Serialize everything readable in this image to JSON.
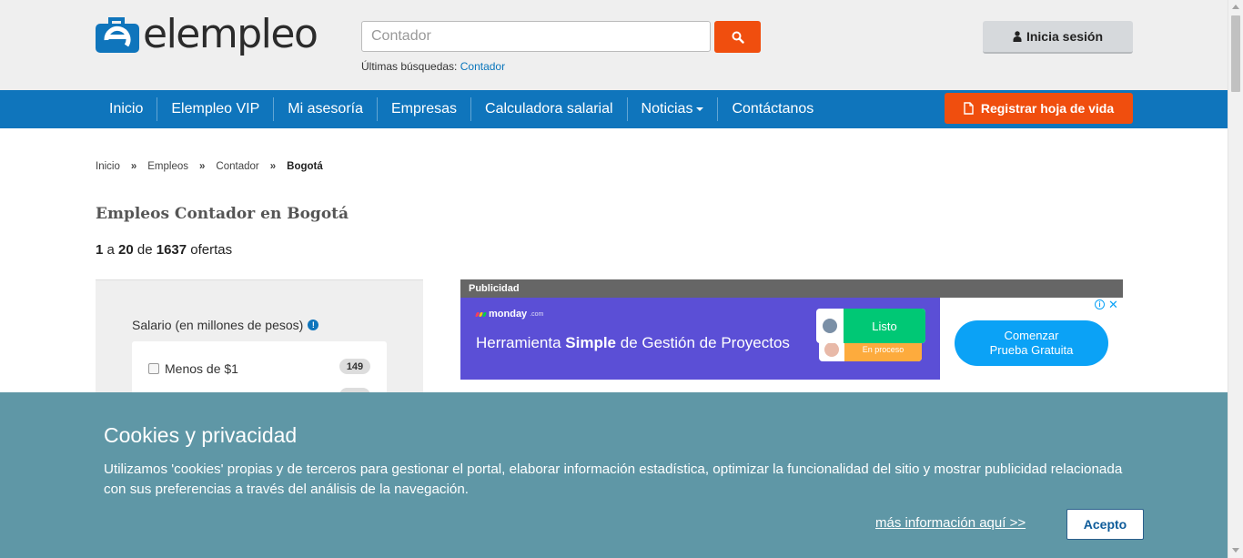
{
  "header": {
    "logo_text": "elempleo",
    "search": {
      "value": "Contador",
      "placeholder": "Contador"
    },
    "recent_label": "Últimas búsquedas:",
    "recent_link": "Contador",
    "login_label": "Inicia sesión"
  },
  "nav": {
    "items": [
      {
        "label": "Inicio"
      },
      {
        "label": "Elempleo VIP"
      },
      {
        "label": "Mi asesoría"
      },
      {
        "label": "Empresas"
      },
      {
        "label": "Calculadora salarial"
      },
      {
        "label": "Noticias"
      },
      {
        "label": "Contáctanos"
      }
    ],
    "register_label": "Registrar hoja de vida"
  },
  "breadcrumb": {
    "items": [
      "Inicio",
      "Empleos",
      "Contador",
      "Bogotá"
    ],
    "separator": "»"
  },
  "main": {
    "title": "Empleos Contador en Bogotá",
    "results": {
      "from": "1",
      "a": "a",
      "to": "20",
      "de": "de",
      "total": "1637",
      "suffix": "ofertas"
    }
  },
  "filters": {
    "salary_title": "Salario (en millones de pesos)",
    "options": [
      {
        "label": "Menos de $1",
        "count": "149"
      }
    ]
  },
  "ad": {
    "header": "Publicidad",
    "brand": "monday",
    "brand_suffix": ".com",
    "headline_pre": "Herramienta ",
    "headline_bold": "Simple",
    "headline_post": " de Gestión de Proyectos",
    "status_done": "Listo",
    "status_progress": "En proceso",
    "cta_line1": "Comenzar",
    "cta_line2": "Prueba Gratuita",
    "colors": {
      "banner": "#5b4fd6",
      "done": "#00c875",
      "progress": "#fdab3d",
      "cta": "#0ba2f6"
    }
  },
  "cookies": {
    "title": "Cookies y privacidad",
    "text": "Utilizamos 'cookies' propias y de terceros para gestionar el portal, elaborar información estadística, optimizar la funcionalidad del sitio y mostrar publicidad relacionada con sus preferencias a través del análisis de la navegación.",
    "more_link": "más información aquí >>",
    "accept_label": "Acepto"
  },
  "colors": {
    "primary_blue": "#0f75bc",
    "accent_orange": "#f04e0e",
    "cookie_bg": "#5f97a6"
  }
}
